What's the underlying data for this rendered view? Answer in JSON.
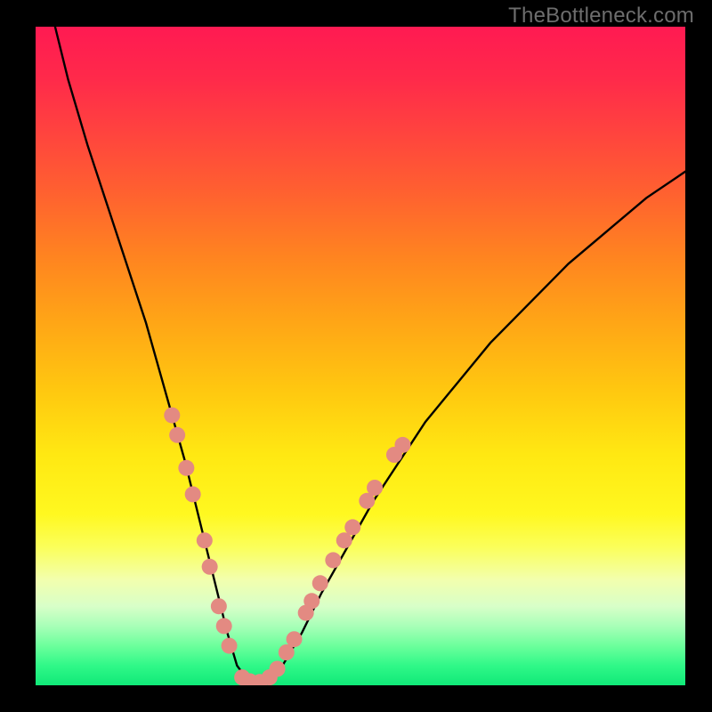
{
  "watermark": {
    "text": "TheBottleneck.com"
  },
  "colors": {
    "stroke": "#000000",
    "dot": "#e38a82",
    "background_black": "#000000"
  },
  "chart_data": {
    "type": "line",
    "title": "",
    "xlabel": "",
    "ylabel": "",
    "xlim": [
      0,
      100
    ],
    "ylim": [
      0,
      100
    ],
    "grid": false,
    "series": [
      {
        "name": "bottleneck-curve",
        "x": [
          3,
          5,
          8,
          11,
          14,
          17,
          19,
          21,
          23,
          25,
          26.5,
          28,
          29.5,
          31,
          32.5,
          34,
          36,
          38,
          41,
          44,
          48,
          52,
          56,
          60,
          65,
          70,
          76,
          82,
          88,
          94,
          100
        ],
        "y": [
          100,
          92,
          82,
          73,
          64,
          55,
          48,
          41,
          34,
          26,
          20,
          14,
          8,
          3,
          1,
          0.5,
          1,
          3,
          8,
          14,
          21,
          28,
          34,
          40,
          46,
          52,
          58,
          64,
          69,
          74,
          78
        ]
      }
    ],
    "highlight_dots": {
      "name": "sample-points",
      "points": [
        {
          "x": 21.0,
          "y": 41
        },
        {
          "x": 21.8,
          "y": 38
        },
        {
          "x": 23.2,
          "y": 33
        },
        {
          "x": 24.2,
          "y": 29
        },
        {
          "x": 26.0,
          "y": 22
        },
        {
          "x": 26.8,
          "y": 18
        },
        {
          "x": 28.2,
          "y": 12
        },
        {
          "x": 29.0,
          "y": 9
        },
        {
          "x": 29.8,
          "y": 6
        },
        {
          "x": 31.8,
          "y": 1.2
        },
        {
          "x": 33.0,
          "y": 0.6
        },
        {
          "x": 34.5,
          "y": 0.5
        },
        {
          "x": 36.0,
          "y": 1.2
        },
        {
          "x": 37.2,
          "y": 2.5
        },
        {
          "x": 38.6,
          "y": 5
        },
        {
          "x": 39.8,
          "y": 7
        },
        {
          "x": 41.6,
          "y": 11
        },
        {
          "x": 42.5,
          "y": 12.8
        },
        {
          "x": 43.8,
          "y": 15.5
        },
        {
          "x": 45.8,
          "y": 19
        },
        {
          "x": 47.5,
          "y": 22
        },
        {
          "x": 48.8,
          "y": 24
        },
        {
          "x": 51.0,
          "y": 28
        },
        {
          "x": 52.2,
          "y": 30
        },
        {
          "x": 55.2,
          "y": 35
        },
        {
          "x": 56.5,
          "y": 36.5
        }
      ]
    }
  }
}
